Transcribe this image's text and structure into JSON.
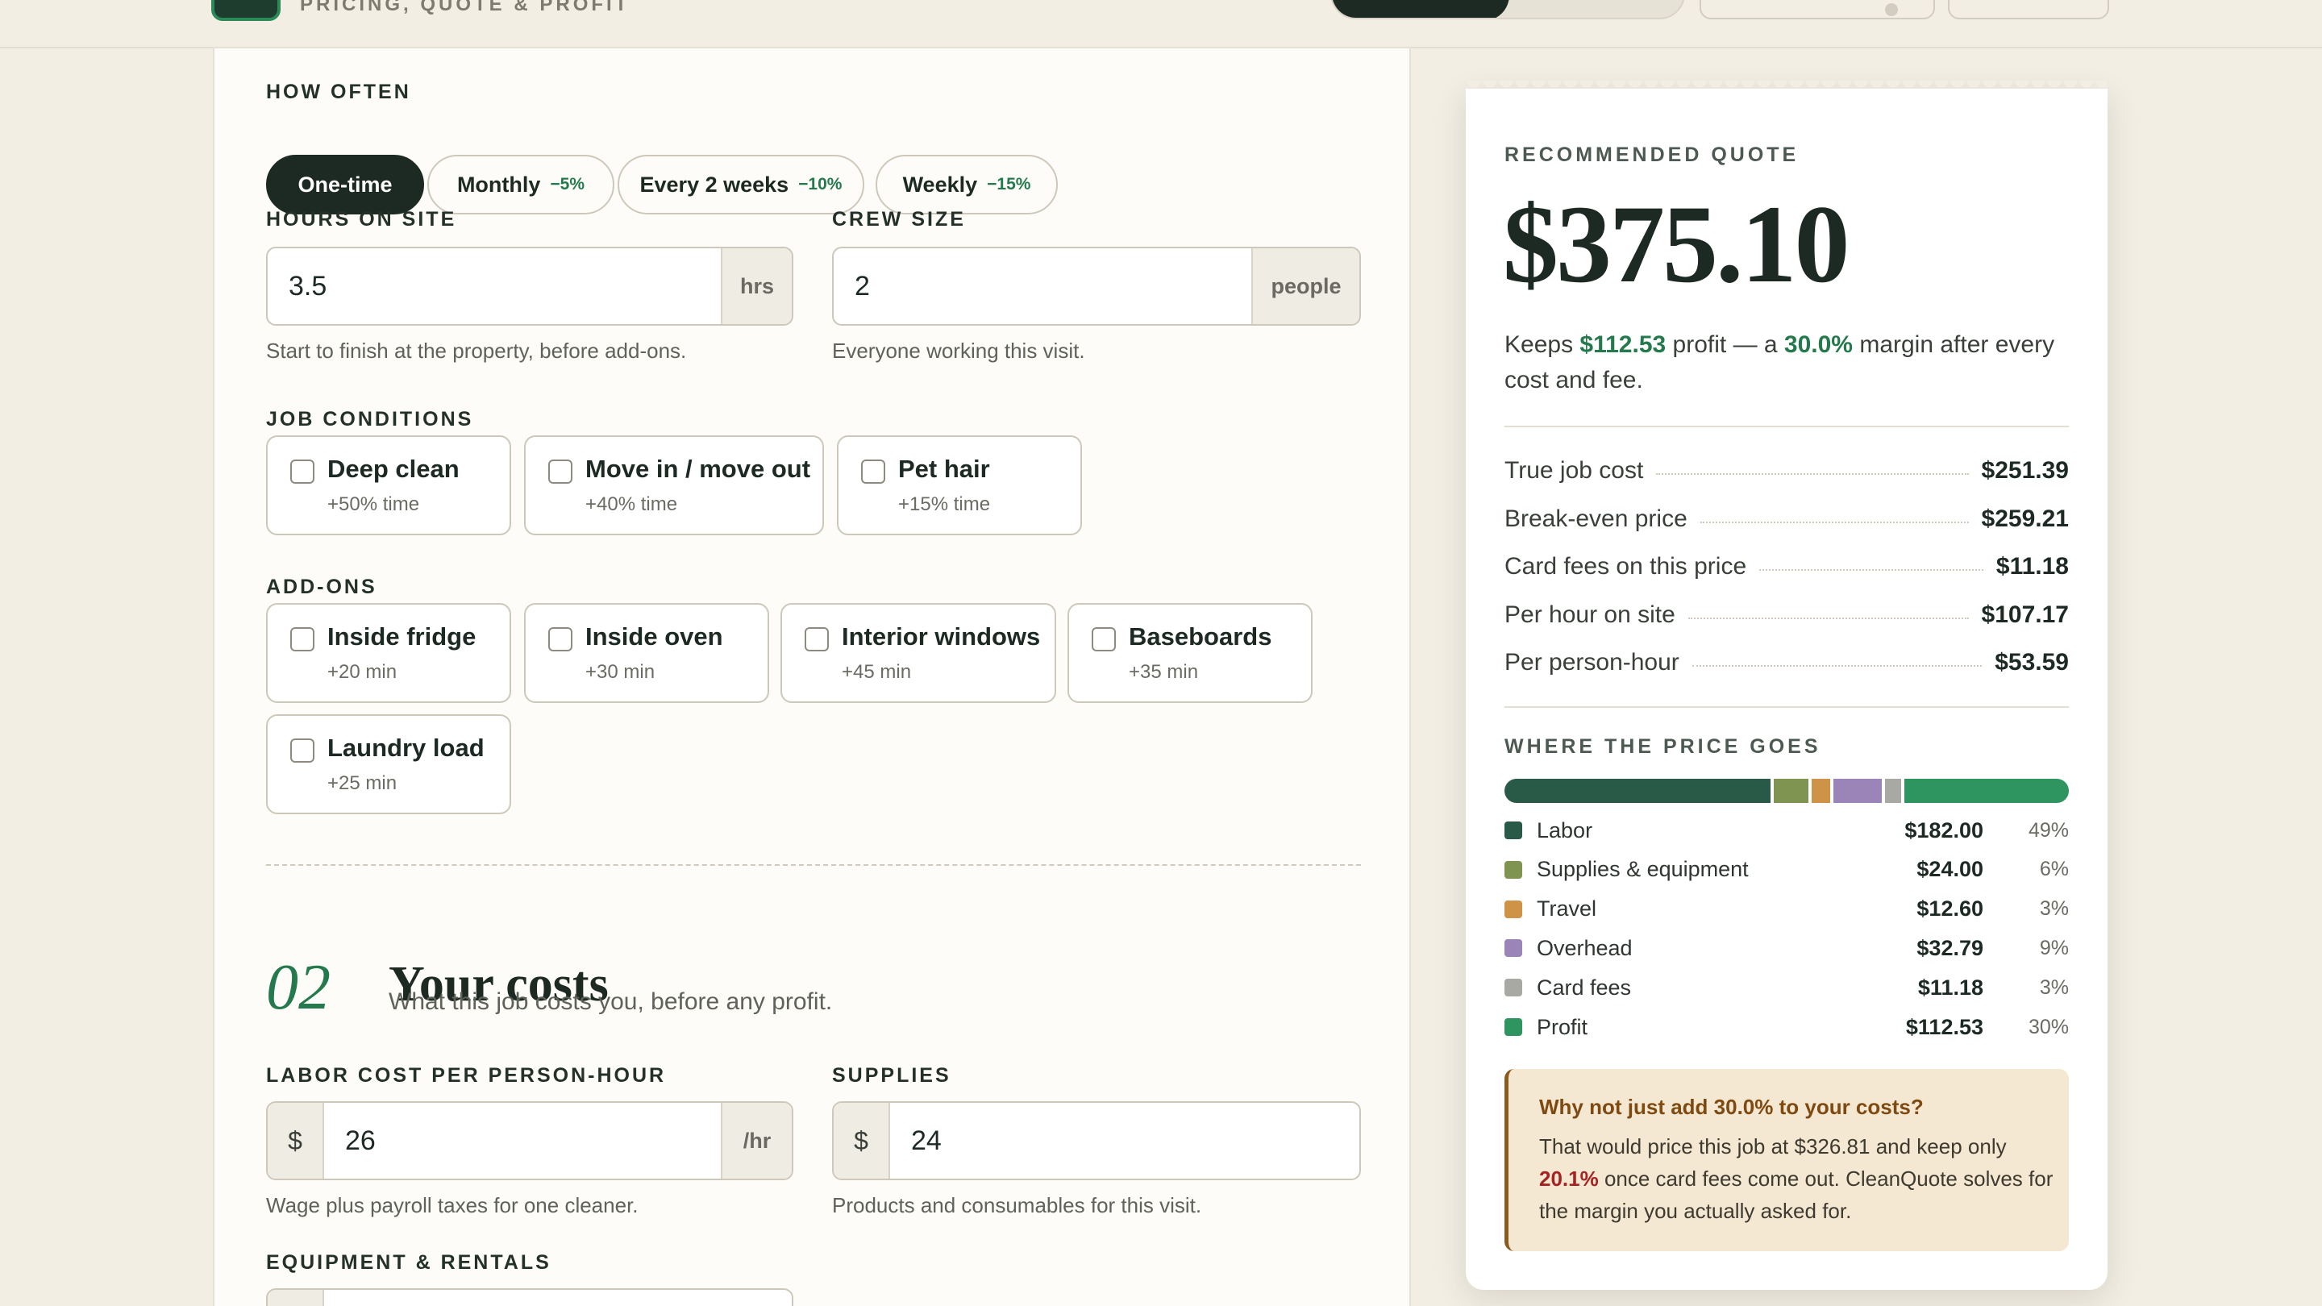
{
  "header": {
    "brand_subtitle": "PRICING, QUOTE & PROFIT"
  },
  "frequency": {
    "label": "HOW OFTEN",
    "options": [
      {
        "label": "One-time",
        "discount": ""
      },
      {
        "label": "Monthly",
        "discount": "−5%"
      },
      {
        "label": "Every 2 weeks",
        "discount": "−10%"
      },
      {
        "label": "Weekly",
        "discount": "−15%"
      }
    ],
    "selected": "One-time"
  },
  "hours": {
    "label": "HOURS ON SITE",
    "value": "3.5",
    "unit": "hrs",
    "hint": "Start to finish at the property, before add-ons."
  },
  "crew": {
    "label": "CREW SIZE",
    "value": "2",
    "unit": "people",
    "hint": "Everyone working this visit."
  },
  "conditions": {
    "label": "JOB CONDITIONS",
    "items": [
      {
        "title": "Deep clean",
        "sub": "+50% time"
      },
      {
        "title": "Move in / move out",
        "sub": "+40% time"
      },
      {
        "title": "Pet hair",
        "sub": "+15% time"
      }
    ]
  },
  "addons": {
    "label": "ADD-ONS",
    "items": [
      {
        "title": "Inside fridge",
        "sub": "+20 min"
      },
      {
        "title": "Inside oven",
        "sub": "+30 min"
      },
      {
        "title": "Interior windows",
        "sub": "+45 min"
      },
      {
        "title": "Baseboards",
        "sub": "+35 min"
      },
      {
        "title": "Laundry load",
        "sub": "+25 min"
      }
    ]
  },
  "section2": {
    "number": "02",
    "title": "Your costs",
    "subtitle": "What this job costs you, before any profit."
  },
  "labor": {
    "label": "LABOR COST PER PERSON-HOUR",
    "prefix": "$",
    "value": "26",
    "unit": "/hr",
    "hint": "Wage plus payroll taxes for one cleaner."
  },
  "supplies": {
    "label": "SUPPLIES",
    "prefix": "$",
    "value": "24",
    "hint": "Products and consumables for this visit."
  },
  "equipment": {
    "label": "EQUIPMENT & RENTALS"
  },
  "quote": {
    "label": "RECOMMENDED QUOTE",
    "price": "$375.10",
    "keeps_pre": "Keeps ",
    "keeps_profit": "$112.53",
    "keeps_mid": " profit — a ",
    "keeps_margin": "30.0%",
    "keeps_post": " margin after every cost and fee.",
    "rows": [
      {
        "label": "True job cost",
        "value": "$251.39"
      },
      {
        "label": "Break-even price",
        "value": "$259.21"
      },
      {
        "label": "Card fees on this price",
        "value": "$11.18"
      },
      {
        "label": "Per hour on site",
        "value": "$107.17"
      },
      {
        "label": "Per person-hour",
        "value": "$53.59"
      }
    ]
  },
  "breakdown": {
    "label": "WHERE THE PRICE GOES",
    "items": [
      {
        "name": "Labor",
        "amount": "$182.00",
        "pct": "49%",
        "share": 48.5,
        "color": "#285a47"
      },
      {
        "name": "Supplies & equipment",
        "amount": "$24.00",
        "pct": "6%",
        "share": 6.4,
        "color": "#7f9450"
      },
      {
        "name": "Travel",
        "amount": "$12.60",
        "pct": "3%",
        "share": 3.4,
        "color": "#cf9347"
      },
      {
        "name": "Overhead",
        "amount": "$32.79",
        "pct": "9%",
        "share": 8.7,
        "color": "#9a84b8"
      },
      {
        "name": "Card fees",
        "amount": "$11.18",
        "pct": "3%",
        "share": 3.0,
        "color": "#a9a9a3"
      },
      {
        "name": "Profit",
        "amount": "$112.53",
        "pct": "30%",
        "share": 30.0,
        "color": "#2f9560"
      }
    ]
  },
  "note": {
    "title": "Why not just add 30.0% to your costs?",
    "pre": "That would price this job at $326.81 and keep only ",
    "highlight": "20.1%",
    "post": " once card fees come out. CleanQuote solves for the margin you actually asked for."
  }
}
